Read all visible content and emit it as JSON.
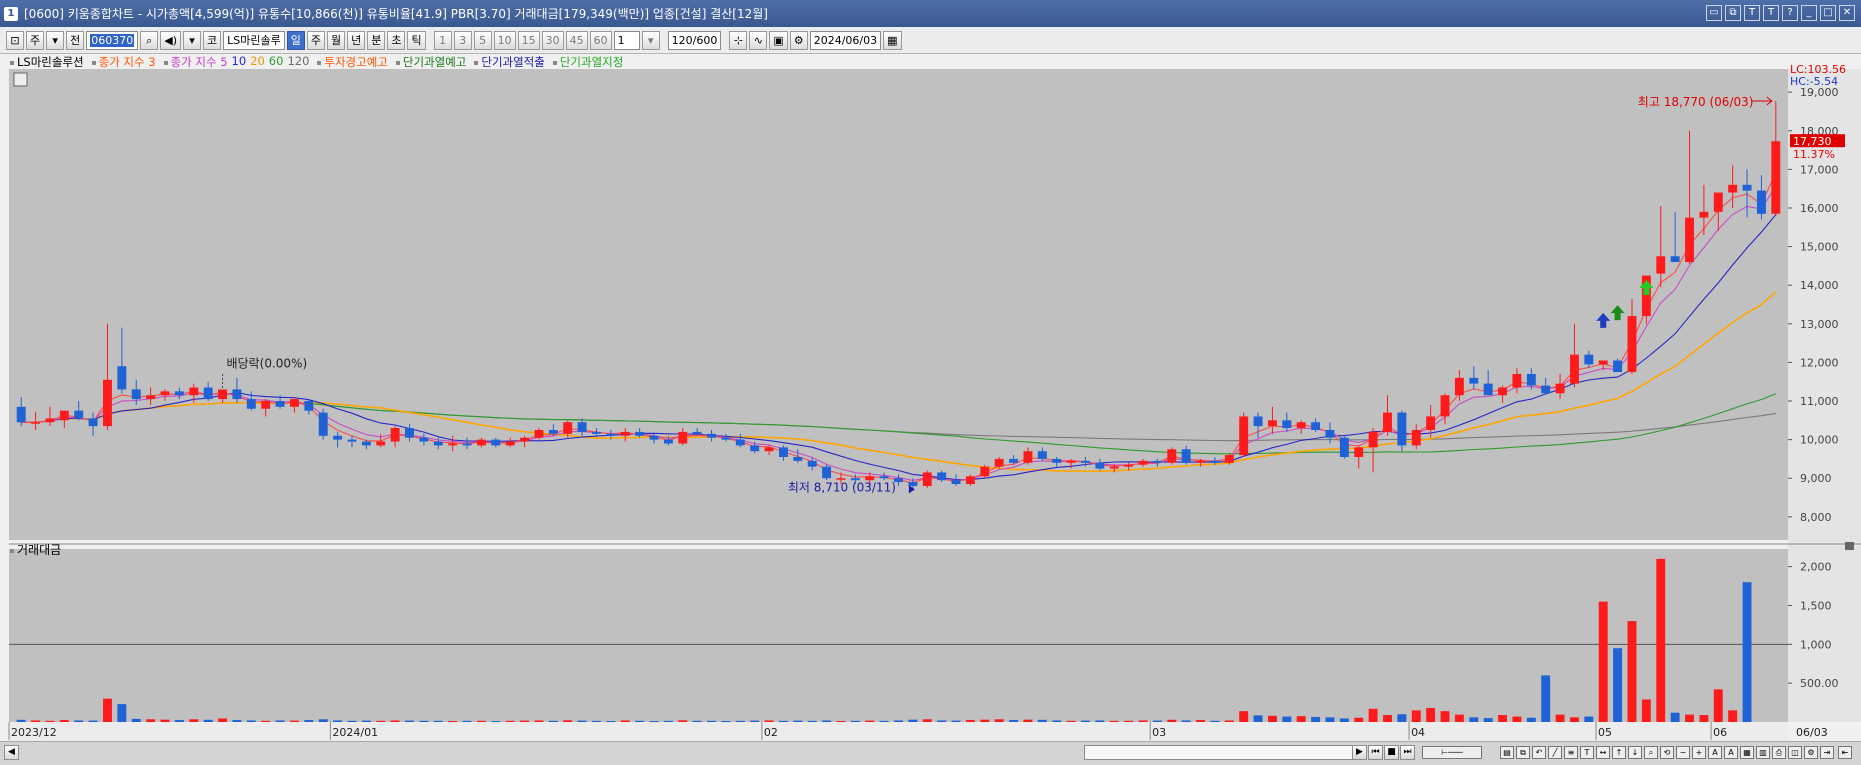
{
  "window": {
    "number_badge": "1",
    "title": "[0600] 키움종합차트 - 시가총액[4,599(억)] 유통수[10,866(천)] 유통비율[41.9] PBR[3.70] 거래대금[179,349(백만)] 업종[건설] 결산[12월]"
  },
  "toolbar": {
    "stock_type": "주",
    "market": "전",
    "stock_code": "060370",
    "market_btn": "코",
    "stock_name": "LS마린솔루",
    "periods": [
      "일",
      "주",
      "월",
      "년",
      "분",
      "초",
      "틱"
    ],
    "selected_period": "일",
    "intervals": [
      "1",
      "3",
      "5",
      "10",
      "15",
      "30",
      "45",
      "60"
    ],
    "interval_value": "1",
    "count": "120",
    "count_total": "/600",
    "date": "2024/06/03"
  },
  "legend": {
    "stock": "LS마린솔루션",
    "ma_a": "종가 지수 3",
    "ma_b": "종가 지수 5",
    "ma_10": "10",
    "ma_20": "20",
    "ma_60": "60",
    "ma_120": "120",
    "warn1": "투자경고예고",
    "warn2": "단기과열예고",
    "warn3": "단기과열적출",
    "warn4": "단기과열지정"
  },
  "right_panel": {
    "lc": "LC:103.56",
    "hc": "HC:-5.54",
    "current_price": "17,730",
    "change": "11.37%"
  },
  "annotations": {
    "high": "최고 18,770 (06/03)",
    "low": "최저 8,710 (03/11)",
    "dividend": "배당락(0.00%)"
  },
  "volume_panel": {
    "title": "거래대금"
  },
  "colors": {
    "up": "#ff1b1b",
    "down": "#1e62d6",
    "ma3": "#ff4a4a",
    "ma5": "#c84cc8",
    "ma10": "#2727c9",
    "ma20": "#ffa500",
    "ma60": "#2d9b2d",
    "ma120": "#7a7a7a",
    "chart_bg": "#c0c0c0"
  },
  "chart_data": [
    {
      "type": "candlestick",
      "title": "LS마린솔루션",
      "ylim": [
        7400,
        19600
      ],
      "y_ticks": [
        "19,000",
        "18,000",
        "17,000",
        "16,000",
        "15,000",
        "14,000",
        "13,000",
        "12,000",
        "11,000",
        "10,000",
        "9,000",
        "8,000"
      ],
      "x_labels": [
        "2023/12",
        "2024/01",
        "02",
        "03",
        "04",
        "05",
        "06",
        "06/03"
      ],
      "series": [
        {
          "name": "종가 지수 3",
          "values": []
        },
        {
          "name": "종가 지수 5",
          "values": []
        },
        {
          "name": "10",
          "values": []
        },
        {
          "name": "20",
          "values": []
        },
        {
          "name": "60",
          "values": []
        },
        {
          "name": "120",
          "values": []
        }
      ],
      "ohlc": [
        [
          10850,
          11100,
          10350,
          10450
        ],
        [
          10450,
          10720,
          10250,
          10450
        ],
        [
          10450,
          10850,
          10350,
          10550
        ],
        [
          10500,
          10750,
          10300,
          10750
        ],
        [
          10750,
          11000,
          10500,
          10550
        ],
        [
          10550,
          10700,
          10100,
          10350
        ],
        [
          10350,
          13000,
          10250,
          11550
        ],
        [
          11900,
          12900,
          11200,
          11300
        ],
        [
          11300,
          11550,
          10900,
          11050
        ],
        [
          11050,
          11350,
          10900,
          11150
        ],
        [
          11150,
          11300,
          11000,
          11250
        ],
        [
          11250,
          11350,
          11050,
          11150
        ],
        [
          11150,
          11450,
          10950,
          11350
        ],
        [
          11350,
          11500,
          11000,
          11050
        ],
        [
          11050,
          11300,
          10950,
          11300
        ],
        [
          11300,
          11600,
          10950,
          11050
        ],
        [
          11050,
          11250,
          10750,
          10800
        ],
        [
          10800,
          11050,
          10600,
          11000
        ],
        [
          11000,
          11150,
          10800,
          10850
        ],
        [
          10850,
          11100,
          10700,
          11050
        ],
        [
          11000,
          11050,
          10650,
          10750
        ],
        [
          10700,
          10800,
          10000,
          10100
        ],
        [
          10100,
          10200,
          9800,
          10000
        ],
        [
          10000,
          10100,
          9800,
          9950
        ],
        [
          9950,
          10000,
          9750,
          9850
        ],
        [
          9850,
          10150,
          9800,
          9950
        ],
        [
          9950,
          10350,
          9800,
          10300
        ],
        [
          10300,
          10400,
          9950,
          10050
        ],
        [
          10050,
          10150,
          9850,
          9950
        ],
        [
          9950,
          10050,
          9750,
          9850
        ],
        [
          9850,
          10100,
          9700,
          9900
        ],
        [
          9900,
          10050,
          9750,
          9850
        ],
        [
          9850,
          10050,
          9800,
          10000
        ],
        [
          10000,
          10050,
          9800,
          9850
        ],
        [
          9850,
          10050,
          9800,
          9950
        ],
        [
          9950,
          10100,
          9800,
          10050
        ],
        [
          10050,
          10300,
          10000,
          10250
        ],
        [
          10250,
          10400,
          10100,
          10150
        ],
        [
          10150,
          10500,
          10050,
          10450
        ],
        [
          10450,
          10550,
          10100,
          10200
        ],
        [
          10200,
          10300,
          10100,
          10150
        ],
        [
          10150,
          10250,
          10000,
          10100
        ],
        [
          10100,
          10300,
          9950,
          10200
        ],
        [
          10200,
          10300,
          10050,
          10100
        ],
        [
          10100,
          10150,
          9900,
          10000
        ],
        [
          10000,
          10100,
          9850,
          9900
        ],
        [
          9900,
          10300,
          9850,
          10200
        ],
        [
          10200,
          10300,
          10100,
          10150
        ],
        [
          10150,
          10250,
          9950,
          10050
        ],
        [
          10050,
          10150,
          9950,
          10000
        ],
        [
          10000,
          10150,
          9800,
          9850
        ],
        [
          9850,
          9950,
          9650,
          9700
        ],
        [
          9700,
          9850,
          9600,
          9800
        ],
        [
          9800,
          9850,
          9450,
          9550
        ],
        [
          9550,
          9750,
          9400,
          9450
        ],
        [
          9450,
          9550,
          9200,
          9300
        ],
        [
          9300,
          9350,
          8950,
          9000
        ],
        [
          9000,
          9150,
          8850,
          9000
        ],
        [
          9000,
          9100,
          8850,
          8950
        ],
        [
          8950,
          9150,
          8800,
          9050
        ],
        [
          9050,
          9150,
          8950,
          9000
        ],
        [
          9000,
          9100,
          8800,
          8900
        ],
        [
          8900,
          9000,
          8710,
          8800
        ],
        [
          8800,
          9200,
          8750,
          9150
        ],
        [
          9150,
          9200,
          8900,
          8950
        ],
        [
          8950,
          9100,
          8800,
          8850
        ],
        [
          8850,
          9100,
          8800,
          9050
        ],
        [
          9050,
          9350,
          9000,
          9300
        ],
        [
          9300,
          9550,
          9250,
          9500
        ],
        [
          9500,
          9600,
          9350,
          9400
        ],
        [
          9400,
          9800,
          9350,
          9700
        ],
        [
          9700,
          9800,
          9450,
          9500
        ],
        [
          9500,
          9550,
          9300,
          9400
        ],
        [
          9400,
          9500,
          9250,
          9450
        ],
        [
          9450,
          9550,
          9300,
          9400
        ],
        [
          9400,
          9500,
          9200,
          9250
        ],
        [
          9250,
          9350,
          9150,
          9300
        ],
        [
          9300,
          9400,
          9200,
          9350
        ],
        [
          9350,
          9500,
          9300,
          9450
        ],
        [
          9450,
          9500,
          9300,
          9400
        ],
        [
          9400,
          9800,
          9350,
          9750
        ],
        [
          9750,
          9850,
          9350,
          9400
        ],
        [
          9400,
          9500,
          9300,
          9450
        ],
        [
          9450,
          9550,
          9350,
          9400
        ],
        [
          9400,
          9650,
          9350,
          9600
        ],
        [
          9600,
          10700,
          9550,
          10600
        ],
        [
          10600,
          10700,
          10050,
          10350
        ],
        [
          10350,
          10850,
          10150,
          10500
        ],
        [
          10500,
          10700,
          10200,
          10300
        ],
        [
          10300,
          10500,
          10150,
          10450
        ],
        [
          10450,
          10550,
          10200,
          10250
        ],
        [
          10250,
          10450,
          9900,
          10050
        ],
        [
          10050,
          10100,
          9500,
          9550
        ],
        [
          9550,
          9850,
          9250,
          9800
        ],
        [
          9800,
          10300,
          9150,
          10200
        ],
        [
          10200,
          11150,
          10100,
          10700
        ],
        [
          10700,
          10750,
          9700,
          9850
        ],
        [
          9850,
          10400,
          9750,
          10250
        ],
        [
          10250,
          10900,
          10050,
          10600
        ],
        [
          10600,
          11200,
          10400,
          11150
        ],
        [
          11150,
          11800,
          11000,
          11600
        ],
        [
          11600,
          11900,
          11300,
          11450
        ],
        [
          11450,
          11800,
          11150,
          11150
        ],
        [
          11150,
          11400,
          10950,
          11350
        ],
        [
          11350,
          11850,
          11200,
          11700
        ],
        [
          11700,
          11850,
          11300,
          11400
        ],
        [
          11400,
          11600,
          11200,
          11200
        ],
        [
          11200,
          11700,
          11050,
          11450
        ],
        [
          11450,
          13000,
          11350,
          12200
        ],
        [
          12200,
          12300,
          11850,
          11950
        ],
        [
          11950,
          12050,
          11800,
          12050
        ],
        [
          12050,
          12100,
          11850,
          11750
        ],
        [
          11750,
          13650,
          11700,
          13200
        ],
        [
          13200,
          14250,
          13000,
          14250
        ],
        [
          14300,
          16050,
          13950,
          14750
        ],
        [
          14750,
          15900,
          14600,
          14600
        ],
        [
          14600,
          18000,
          14550,
          15750
        ],
        [
          15750,
          16600,
          15300,
          15900
        ],
        [
          15900,
          16300,
          15400,
          16400
        ],
        [
          16400,
          17100,
          16000,
          16600
        ],
        [
          16600,
          17000,
          15750,
          16450
        ],
        [
          16450,
          16850,
          15700,
          15850
        ],
        [
          15850,
          18770,
          15800,
          17730
        ]
      ]
    },
    {
      "type": "bar",
      "title": "거래대금",
      "ylim": [
        0,
        2150
      ],
      "y_ticks": [
        "2,000",
        "1,500",
        "1,000",
        "500.00"
      ],
      "values": [
        28,
        20,
        15,
        25,
        20,
        18,
        300,
        230,
        40,
        35,
        30,
        25,
        35,
        28,
        45,
        25,
        20,
        15,
        20,
        18,
        25,
        35,
        20,
        15,
        18,
        15,
        20,
        18,
        15,
        15,
        12,
        15,
        15,
        12,
        15,
        18,
        20,
        15,
        22,
        18,
        15,
        12,
        20,
        15,
        12,
        15,
        22,
        15,
        15,
        12,
        15,
        18,
        20,
        15,
        18,
        15,
        20,
        12,
        15,
        18,
        15,
        20,
        30,
        35,
        20,
        18,
        25,
        30,
        35,
        25,
        30,
        28,
        20,
        15,
        18,
        20,
        15,
        15,
        20,
        18,
        28,
        20,
        25,
        15,
        20,
        140,
        85,
        80,
        70,
        75,
        65,
        60,
        45,
        55,
        170,
        90,
        100,
        150,
        180,
        140,
        95,
        60,
        50,
        90,
        70,
        55,
        600,
        95,
        60,
        70,
        1550,
        950,
        1300,
        290,
        2100,
        120,
        95,
        90,
        420,
        150,
        1800
      ]
    }
  ]
}
